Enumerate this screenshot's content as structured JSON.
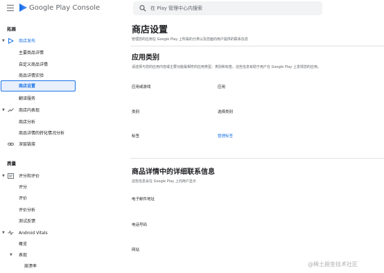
{
  "header": {
    "brand": "Google Play Console",
    "search_placeholder": "在 Play 管理中心内搜索"
  },
  "sidebar": {
    "section_grow": "拓展",
    "section_quality": "质量",
    "items": [
      {
        "label": "商店发布"
      },
      {
        "label": "主要商品详情"
      },
      {
        "label": "自定义商品详情"
      },
      {
        "label": "商品详情实验"
      },
      {
        "label": "商店设置"
      },
      {
        "label": "翻译服务"
      },
      {
        "label": "商店内表现"
      },
      {
        "label": "商店分析"
      },
      {
        "label": "商品详情的转化情况分析"
      },
      {
        "label": "深层链接"
      },
      {
        "label": "评分和评价"
      },
      {
        "label": "评分"
      },
      {
        "label": "评价"
      },
      {
        "label": "评价分析"
      },
      {
        "label": "测试反馈"
      },
      {
        "label": "Android Vitals"
      },
      {
        "label": "概览"
      },
      {
        "label": "表现"
      },
      {
        "label": "崩溃率"
      }
    ]
  },
  "main": {
    "title": "商店设置",
    "description": "管理您的应用在 Google Play 上所属的分类以及您面向用户提供的联系信息",
    "category": {
      "title": "应用类别",
      "description": "请选择与您的应用内容或主要功能最相符的应用类型、类别和标签。这些信息有助于用户在 Google Play 上发现您的应用。",
      "fields": {
        "type_label": "应用或游戏",
        "type_value": "应用",
        "category_label": "类别",
        "category_value": "选择类别",
        "tags_label": "标签",
        "tags_link": "管理标签"
      }
    },
    "contact": {
      "title": "商品详情中的详细联系信息",
      "description": "这些信息会在 Google Play 上向用户显示",
      "email_label": "电子邮件地址",
      "phone_label": "电话号码",
      "website_label": "网站"
    }
  },
  "watermark": "@稀土掘金技术社区",
  "colors": {
    "accent": "#1a73e8",
    "selected_bg": "#e8f0fe",
    "text": "#202124",
    "muted": "#5f6368"
  }
}
